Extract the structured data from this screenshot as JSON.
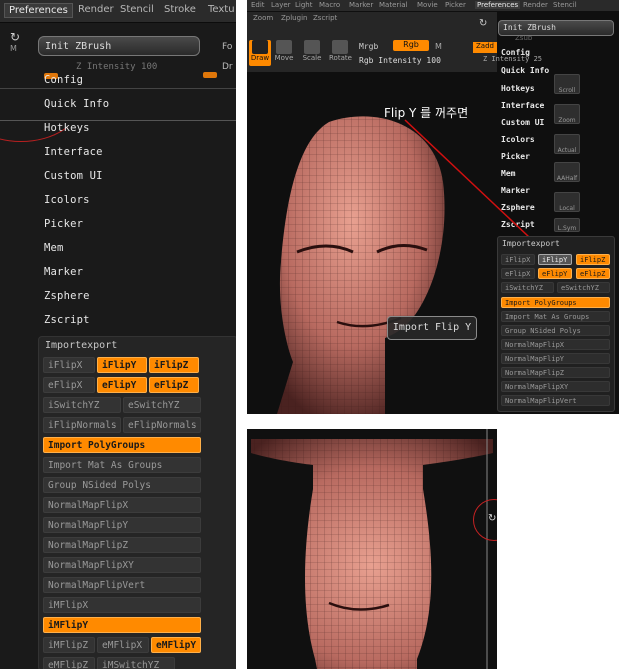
{
  "left_panel": {
    "tabs": [
      "Preferences",
      "Render",
      "Stencil",
      "Stroke",
      "Textu"
    ],
    "init_label": "Init ZBrush",
    "z_intensity": "Z Intensity 100",
    "menu": [
      "Config",
      "Quick Info",
      "Hotkeys",
      "Interface",
      "Custom UI",
      "Icolors",
      "Picker",
      "Mem",
      "Marker",
      "Zsphere",
      "Zscript"
    ],
    "sub_title": "Importexport",
    "buttons": [
      "iFlipX",
      "iFlipY",
      "iFlipZ",
      "eFlipX",
      "eFlipY",
      "eFlipZ",
      "iSwitchYZ",
      "eSwitchYZ",
      "iFlipNormals",
      "eFlipNormals",
      "Import PolyGroups",
      "Import Mat As Groups",
      "Group NSided Polys",
      "NormalMapFlipX",
      "NormalMapFlipY",
      "NormalMapFlipZ",
      "NormalMapFlipXY",
      "NormalMapFlipVert",
      "iMFlipX",
      "iMFlipY",
      "iMFlipZ",
      "eMFlipX",
      "eMFlipY",
      "eMFlipZ",
      "iMSwitchYZ"
    ],
    "edge_labels": [
      "M",
      "Fo",
      "Dr"
    ]
  },
  "top_right": {
    "menus": [
      "Edit",
      "Layer",
      "Light",
      "Macro",
      "Marker",
      "Material",
      "Movie",
      "Picker",
      "Preferences",
      "Render",
      "Stencil"
    ],
    "menus2": [
      "Zoom",
      "Zplugin",
      "Zscript"
    ],
    "tools": [
      "Draw",
      "Move",
      "Scale",
      "Rotate"
    ],
    "mrgb": "Mrgb",
    "rgb": "Rgb",
    "m": "M",
    "rgb_intensity": "Rgb Intensity 100",
    "zadd": "Zadd",
    "zsub": "Zsub",
    "z_intensity": "Z Intensity 25",
    "init_label": "Init ZBrush",
    "menu": [
      "Config",
      "Quick Info",
      "Hotkeys",
      "Interface",
      "Custom UI",
      "Icolors",
      "Picker",
      "Mem",
      "Marker",
      "Zsphere",
      "Zscript"
    ],
    "side_buttons": [
      "Scroll",
      "Zoom",
      "Actual",
      "AAHalf",
      "Local",
      "L.Sym"
    ],
    "sub_title": "Importexport",
    "buttons": [
      "iFlipX",
      "iFlipY",
      "iFlipZ",
      "eFlipX",
      "eFlipY",
      "eFlipZ",
      "iSwitchYZ",
      "eSwitchYZ",
      "Import PolyGroups",
      "Import Mat As Groups",
      "Group NSided Polys",
      "NormalMapFlipX",
      "NormalMapFlipY",
      "NormalMapFlipZ",
      "NormalMapFlipXY",
      "NormalMapFlipVert"
    ],
    "annotation": "Flip Y 를 꺼주면",
    "tooltip": "Import Flip Y"
  },
  "colors": {
    "accent": "#ff8a00",
    "skin": "#d98a80",
    "annot_line": "#d01010"
  }
}
